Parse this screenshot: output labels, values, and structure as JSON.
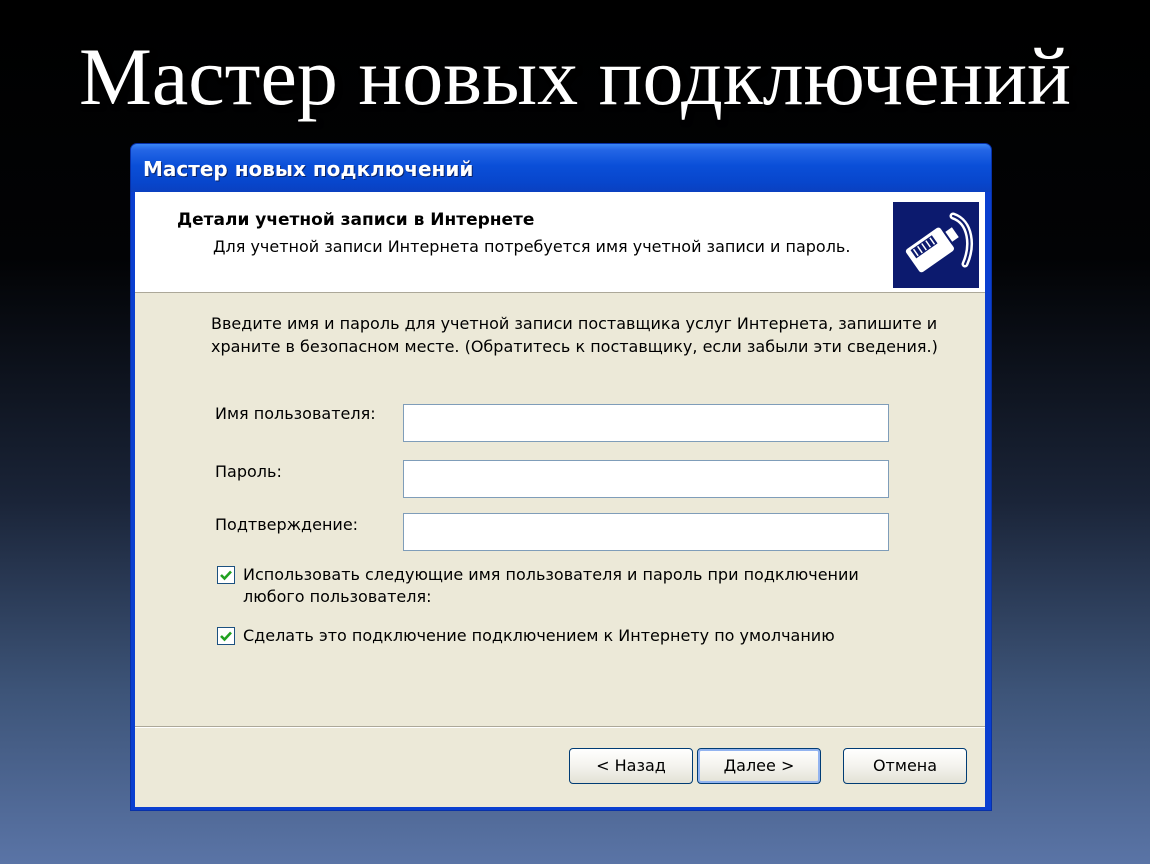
{
  "slide": {
    "title": "Мастер новых подключений"
  },
  "window": {
    "title": "Мастер новых подключений"
  },
  "header": {
    "title": "Детали учетной записи в Интернете",
    "subtitle": "Для учетной записи Интернета потребуется имя учетной записи и пароль.",
    "icon": "network-cable-icon"
  },
  "body": {
    "instructions": "Введите имя и пароль для учетной записи поставщика услуг Интернета, запишите и храните в безопасном месте. (Обратитесь к поставщику, если забыли эти сведения.)"
  },
  "form": {
    "username_label": "Имя пользователя:",
    "username_value": "",
    "password_label": "Пароль:",
    "password_value": "",
    "confirm_label": "Подтверждение:",
    "confirm_value": ""
  },
  "options": {
    "use_for_all_label": "Использовать следующие имя пользователя и пароль при подключении любого пользователя:",
    "use_for_all_checked": true,
    "default_connection_label": "Сделать это подключение подключением к Интернету по умолчанию",
    "default_connection_checked": true
  },
  "buttons": {
    "back": "< Назад",
    "next": "Далее >",
    "cancel": "Отмена"
  },
  "colors": {
    "titlebar": "#0a4fd8",
    "dialog_bg": "#ece9d8",
    "checkmark": "#21a121"
  }
}
